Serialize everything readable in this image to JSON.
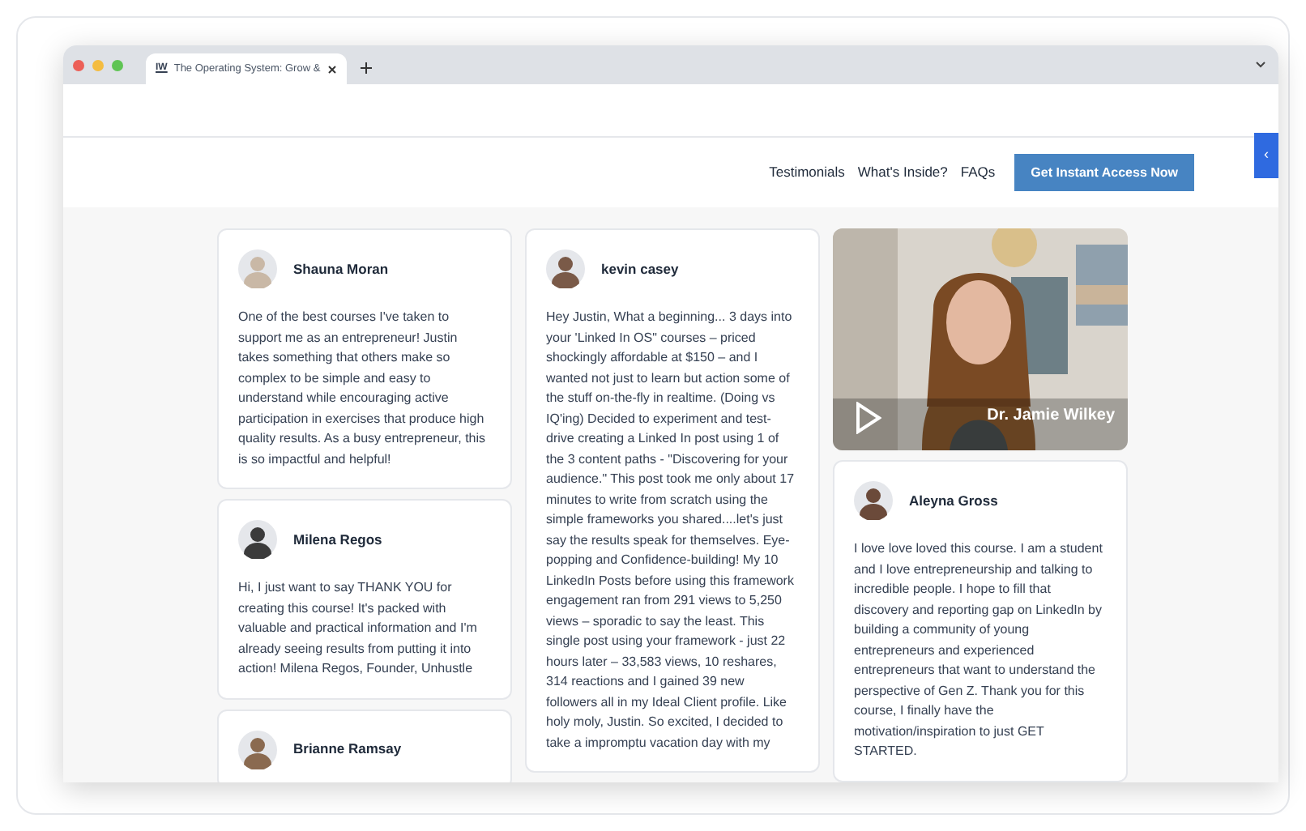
{
  "browser": {
    "tab_title": "The Operating System: Grow &",
    "favicon": "IW"
  },
  "nav": {
    "links": [
      {
        "label": "Testimonials"
      },
      {
        "label": "What's Inside?"
      },
      {
        "label": "FAQs"
      }
    ],
    "cta": "Get Instant Access Now",
    "side_tab": "‹"
  },
  "columns": [
    [
      {
        "kind": "text",
        "name": "Shauna Moran",
        "text": "One of the best courses I've taken to support me as an entrepreneur! Justin takes something that others make so complex to be simple and easy to understand while encouraging active participation in exercises that produce high quality results. As a busy entrepreneur, this is so impactful and helpful!"
      },
      {
        "kind": "text",
        "name": "Milena Regos",
        "text": "Hi, I just want to say THANK YOU for creating this course! It's packed with valuable and practical information and I'm already seeing results from putting it into action! Milena Regos, Founder, Unhustle"
      },
      {
        "kind": "text",
        "name": "Brianne Ramsay"
      }
    ],
    [
      {
        "kind": "text",
        "name": "kevin casey",
        "text": "Hey Justin, What a beginning... 3 days into your 'Linked In OS\" courses – priced shockingly affordable at $150 – and I wanted not just to learn but action some of the stuff on-the-fly in realtime. (Doing vs IQ'ing) Decided to experiment and test-drive creating a Linked In post using 1 of the 3 content paths - \"Discovering for your audience.\" This post took me only about 17 minutes to write from scratch using the simple frameworks you shared....let's just say the results speak for themselves. Eye-popping and Confidence-building! My 10 LinkedIn Posts before using this framework engagement ran from 291 views to 5,250 views – sporadic to say the least. This single post using your framework - just 22 hours later – 33,583 views, 10 reshares, 314 reactions and I gained 39 new followers all in my Ideal Client profile. Like holy moly, Justin. So excited, I decided to take a impromptu vacation day with my"
      }
    ],
    [
      {
        "kind": "video",
        "name": "Dr. Jamie Wilkey"
      },
      {
        "kind": "text",
        "name": "Aleyna Gross",
        "text": "I love love loved this course. I am a student and I love entrepreneurship and talking to incredible people. I hope to fill that discovery and reporting gap on LinkedIn by building a community of young entrepreneurs and experienced entrepreneurs that want to understand the perspective of Gen Z. Thank you for this course, I finally have the motivation/inspiration to just GET STARTED."
      }
    ]
  ]
}
